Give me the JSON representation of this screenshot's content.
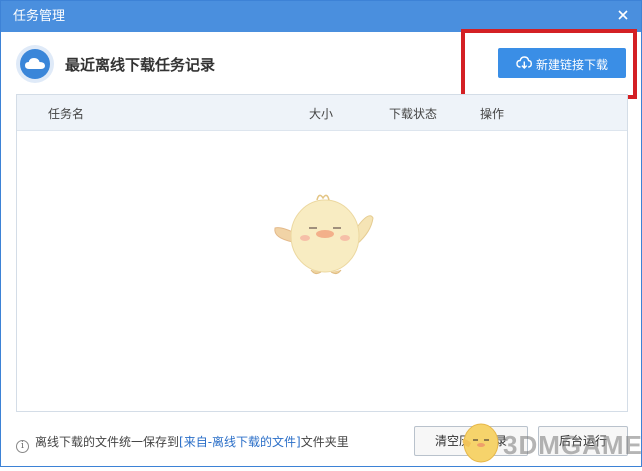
{
  "window": {
    "title": "任务管理",
    "close_icon": "close-icon"
  },
  "header": {
    "icon": "cloud-icon",
    "heading": "最近离线下载任务记录",
    "new_link_button": {
      "icon": "cloud-download-icon",
      "label": "新建链接下载"
    },
    "highlight_color": "#d42024"
  },
  "table": {
    "columns": [
      "任务名",
      "大小",
      "下载状态",
      "操作"
    ],
    "rows": [],
    "empty_illustration": "mascot-chick"
  },
  "footer": {
    "info_icon": "info-icon",
    "info_prefix": "离线下载的文件统一保存到",
    "info_link": "[来自-离线下载的文件]",
    "info_suffix": "文件夹里",
    "clear_history_button": "清空历史记录",
    "background_run_button": "后台运行"
  },
  "watermark": {
    "text": "3DMGAME"
  },
  "colors": {
    "accent": "#3a8ee6",
    "titlebar": "#4a8fde",
    "link": "#2b6fc8"
  }
}
